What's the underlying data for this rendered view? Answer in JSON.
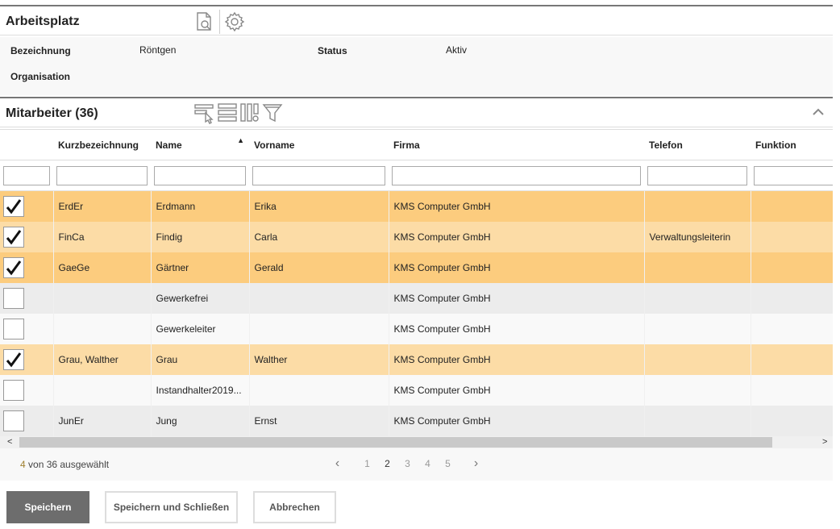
{
  "arbeitsplatz": {
    "title": "Arbeitsplatz",
    "icons": [
      "document-search-icon",
      "gear-icon"
    ],
    "fields": {
      "bezeichnung_label": "Bezeichnung",
      "bezeichnung_value": "Röntgen",
      "status_label": "Status",
      "status_value": "Aktiv",
      "organisation_label": "Organisation",
      "organisation_value": ""
    }
  },
  "mitarbeiter": {
    "title": "Mitarbeiter (36)",
    "toolbar_icons": [
      "select-rows-icon",
      "list-view-icon",
      "column-settings-icon",
      "filter-icon"
    ],
    "collapse_icon": "chevron-up-icon",
    "columns": [
      "",
      "Kurzbezeichnung",
      "Name",
      "Vorname",
      "Firma",
      "Telefon",
      "Funktion"
    ],
    "sorted_column": "Name",
    "filters": [
      "",
      "",
      "",
      "",
      "",
      "",
      ""
    ],
    "rows": [
      {
        "checked": true,
        "kurz": "ErdEr",
        "name": "Erdmann",
        "vorname": "Erika",
        "firma": "KMS Computer GmbH",
        "telefon": "",
        "funktion": ""
      },
      {
        "checked": true,
        "kurz": "FinCa",
        "name": "Findig",
        "vorname": "Carla",
        "firma": "KMS Computer GmbH",
        "telefon": "Verwaltungsleiterin",
        "funktion": ""
      },
      {
        "checked": true,
        "kurz": "GaeGe",
        "name": "Gärtner",
        "vorname": "Gerald",
        "firma": "KMS Computer GmbH",
        "telefon": "",
        "funktion": ""
      },
      {
        "checked": false,
        "kurz": "",
        "name": "Gewerkefrei",
        "vorname": "",
        "firma": "KMS Computer GmbH",
        "telefon": "",
        "funktion": ""
      },
      {
        "checked": false,
        "kurz": "",
        "name": "Gewerkeleiter",
        "vorname": "",
        "firma": "KMS Computer GmbH",
        "telefon": "",
        "funktion": ""
      },
      {
        "checked": true,
        "kurz": "Grau, Walther",
        "name": "Grau",
        "vorname": "Walther",
        "firma": "KMS Computer GmbH",
        "telefon": "",
        "funktion": ""
      },
      {
        "checked": false,
        "kurz": "",
        "name": "Instandhalter2019...",
        "vorname": "",
        "firma": "KMS Computer GmbH",
        "telefon": "",
        "funktion": ""
      },
      {
        "checked": false,
        "kurz": "JunEr",
        "name": "Jung",
        "vorname": "Ernst",
        "firma": "KMS Computer GmbH",
        "telefon": "",
        "funktion": ""
      }
    ],
    "selection_count": "4",
    "selection_text": " von 36 ausgewählt",
    "pages": [
      "1",
      "2",
      "3",
      "4",
      "5"
    ],
    "current_page": "2"
  },
  "buttons": {
    "save": "Speichern",
    "save_close": "Speichern und Schließen",
    "cancel": "Abbrechen"
  },
  "colors": {
    "selected_row": "#fccc7e",
    "selected_row_alt": "#fcdca6",
    "primary_button": "#6d6d6d"
  }
}
